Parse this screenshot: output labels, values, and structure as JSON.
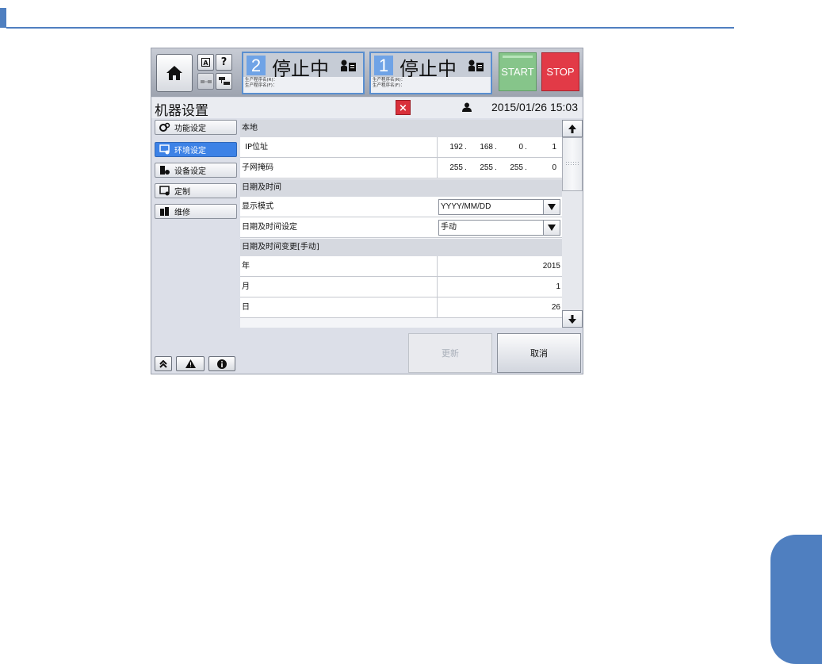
{
  "header": {
    "units": [
      {
        "number": "2",
        "state": "停止中",
        "program_r": "生产程序名(R)：",
        "program_f": "生产程序名(F)："
      },
      {
        "number": "1",
        "state": "停止中",
        "program_r": "生产程序名(R)：",
        "program_f": "生产程序名(F)："
      }
    ],
    "small_buttons": {
      "a_label": "A",
      "help_label": "?"
    },
    "start_label": "START",
    "stop_label": "STOP"
  },
  "titlebar": {
    "title": "机器设置",
    "close_label": "×",
    "datetime": "2015/01/26 15:03"
  },
  "nav": {
    "items": [
      {
        "label": "功能设定",
        "icon": "gears-icon",
        "active": false
      },
      {
        "label": "环境设定",
        "icon": "monitor-settings-icon",
        "active": true
      },
      {
        "label": "设备设定",
        "icon": "device-settings-icon",
        "active": false
      },
      {
        "label": "定制",
        "icon": "customize-icon",
        "active": false
      },
      {
        "label": "维修",
        "icon": "maintenance-icon",
        "active": false
      }
    ]
  },
  "content": {
    "section_local": "本地",
    "ip_label": "IP位址",
    "ip_parts": [
      "192",
      "168",
      "0",
      "1"
    ],
    "subnet_label": "子网掩码",
    "subnet_parts": [
      "255",
      "255",
      "255",
      "0"
    ],
    "section_datetime": "日期及时间",
    "display_mode_label": "显示模式",
    "display_mode_value": "YYYY/MM/DD",
    "datetime_setting_label": "日期及时间设定",
    "datetime_setting_value": "手动",
    "section_change": "日期及时间变更[手动]",
    "year_label": "年",
    "year_value": "2015",
    "month_label": "月",
    "month_value": "1",
    "day_label": "日",
    "day_value": "26"
  },
  "footer": {
    "update_label": "更新",
    "cancel_label": "取消"
  },
  "colors": {
    "accent_blue": "#4f7fc0",
    "active_nav": "#3d82e6",
    "start_green": "#86c58a",
    "stop_red": "#e23a47",
    "close_red": "#d9303a"
  }
}
